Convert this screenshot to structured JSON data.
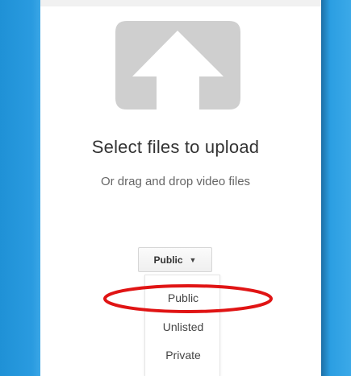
{
  "upload": {
    "title": "Select files to upload",
    "subtitle": "Or drag and drop video files",
    "icon": "upload-arrow-icon"
  },
  "privacy": {
    "selected_label": "Public",
    "caret": "▼",
    "options": [
      "Public",
      "Unlisted",
      "Private"
    ]
  },
  "colors": {
    "side_blue": "#2a9be0",
    "icon_gray": "#cfcfcf",
    "highlight_red": "#e01414"
  }
}
